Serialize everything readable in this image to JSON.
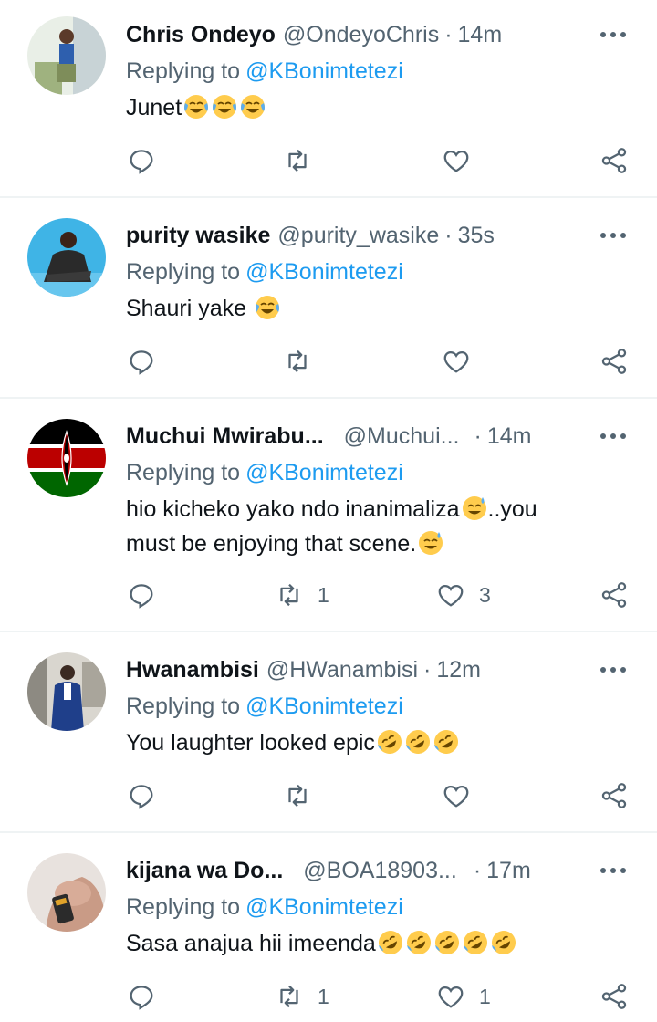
{
  "replying_prefix": "Replying to",
  "colors": {
    "link": "#1d9bf0",
    "secondary": "#536471",
    "text": "#0f1419",
    "divider": "#eff3f4"
  },
  "tweets": [
    {
      "name": "Chris Ondeyo",
      "handle": "@OndeyoChris",
      "separator": "·",
      "time": "14m",
      "replying_to": "@KBonimtetezi",
      "text_before": "Junet",
      "emojis": [
        "joy",
        "joy",
        "joy"
      ],
      "text_after": "",
      "line2": "",
      "line2_emojis": [],
      "retweets": "",
      "likes": "",
      "avatar": "person-photo"
    },
    {
      "name": "purity wasike",
      "handle": "@purity_wasike",
      "separator": "·",
      "time": "35s",
      "replying_to": "@KBonimtetezi",
      "text_before": "Shauri yake ",
      "emojis": [
        "joy"
      ],
      "text_after": "",
      "line2": "",
      "line2_emojis": [],
      "retweets": "",
      "likes": "",
      "avatar": "person-photo"
    },
    {
      "name": "Muchui Mwirabu...",
      "handle": "@Muchui...",
      "separator": "·",
      "time": "14m",
      "replying_to": "@KBonimtetezi",
      "text_before": "hio kicheko yako ndo inanimaliza",
      "emojis": [
        "sweat-smile"
      ],
      "text_after": "..you",
      "line2": "must be enjoying that scene.",
      "line2_emojis": [
        "sweat-smile"
      ],
      "retweets": "1",
      "likes": "3",
      "avatar": "kenya-flag"
    },
    {
      "name": "Hwanambisi",
      "handle": "@HWanambisi",
      "separator": "·",
      "time": "12m",
      "replying_to": "@KBonimtetezi",
      "text_before": "You laughter looked epic",
      "emojis": [
        "rofl",
        "rofl",
        "rofl"
      ],
      "text_after": "",
      "line2": "",
      "line2_emojis": [],
      "retweets": "",
      "likes": "",
      "avatar": "person-photo"
    },
    {
      "name": "kijana wa Do...",
      "handle": "@BOA18903...",
      "separator": "·",
      "time": "17m",
      "replying_to": "@KBonimtetezi",
      "text_before": "Sasa anajua hii imeenda",
      "emojis": [
        "rofl",
        "rofl",
        "rofl",
        "rofl",
        "rofl"
      ],
      "text_after": "",
      "line2": "",
      "line2_emojis": [],
      "retweets": "1",
      "likes": "1",
      "avatar": "person-photo"
    }
  ],
  "icons": {
    "reply": "reply-icon",
    "retweet": "retweet-icon",
    "like": "like-icon",
    "share": "share-icon",
    "more": "more-icon"
  }
}
